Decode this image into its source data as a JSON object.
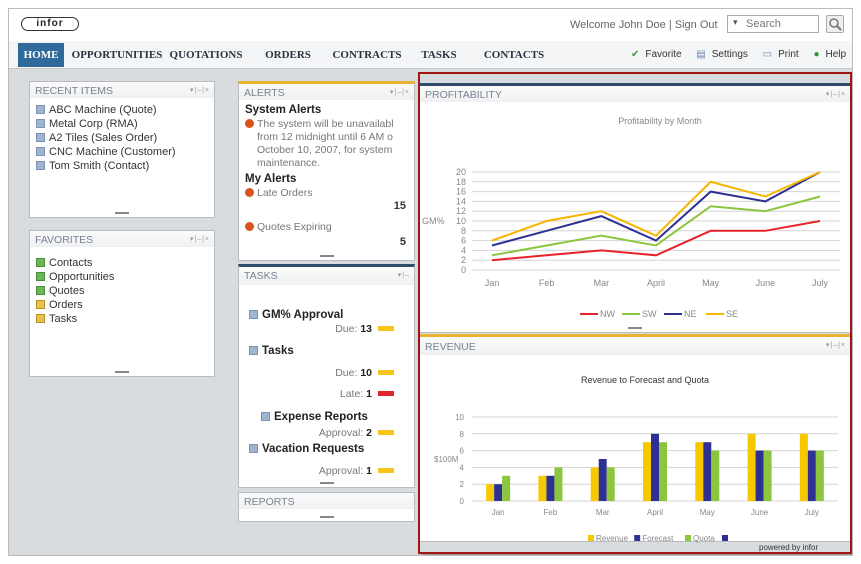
{
  "app": {
    "logo": "infor",
    "welcome": "Welcome John Doe | Sign Out",
    "search_placeholder": "Search",
    "search_dropdown": "▾",
    "powered": "powered by infor"
  },
  "nav": {
    "tabs": [
      "HOME",
      "OPPORTUNITIES",
      "QUOTATIONS",
      "ORDERS",
      "CONTRACTS",
      "TASKS",
      "CONTACTS"
    ],
    "active": "HOME"
  },
  "tools": {
    "favorite": "Favorite",
    "settings": "Settings",
    "print": "Print",
    "help": "Help",
    "more": ">>"
  },
  "recent": {
    "title": "RECENT ITEMS",
    "items": [
      "ABC Machine (Quote)",
      "Metal Corp (RMA)",
      "A2 Tiles (Sales Order)",
      "CNC Machine (Customer)",
      "Tom Smith (Contact)"
    ]
  },
  "favorites": {
    "title": "FAVORITES",
    "items": [
      "Contacts",
      "Opportunities",
      "Quotes",
      "Orders",
      "Tasks"
    ]
  },
  "alerts": {
    "title": "ALERTS",
    "system_title": "System Alerts",
    "system_text": [
      "The system will be unavailabl",
      "from 12 midnight until 6 AM o",
      "October 10, 2007, for system",
      "maintenance."
    ],
    "my_title": "My Alerts",
    "late_label": "Late Orders",
    "late_count": "15",
    "exp_label": "Quotes Expiring",
    "exp_count": "5"
  },
  "tasks": {
    "title": "TASKS",
    "gm": "GM% Approval",
    "gm_due_label": "Due:",
    "gm_due": "13",
    "tasks_label": "Tasks",
    "due_label": "Due:",
    "due": "10",
    "late_label": "Late:",
    "late": "1",
    "exp": "Expense Reports",
    "exp_appr_label": "Approval:",
    "exp_appr": "2",
    "vac": "Vacation Requests",
    "vac_appr_label": "Approval:",
    "vac_appr": "1"
  },
  "reports": {
    "title": "REPORTS"
  },
  "profitability": {
    "title": "PROFITABILITY"
  },
  "revenue": {
    "title": "REVENUE"
  },
  "colors": {
    "nw": "#e8242b",
    "sw": "#8cc63f",
    "ne": "#2e3192",
    "se": "#f7b500",
    "revenue": "#f7c800",
    "forecast": "#2e3192",
    "quota": "#8cc63f",
    "accent": "#2f6a9a",
    "highlight": "#a31414"
  },
  "chart_data": [
    {
      "type": "line",
      "title": "Profitability by Month",
      "ylabel": "GM%",
      "categories": [
        "Jan",
        "Feb",
        "Mar",
        "April",
        "May",
        "June",
        "July"
      ],
      "ylim": [
        0,
        20
      ],
      "yticks": [
        0,
        2,
        4,
        6,
        8,
        10,
        12,
        14,
        16,
        18,
        20
      ],
      "grid": true,
      "legend_position": "bottom",
      "series": [
        {
          "name": "NW",
          "values": [
            2,
            3,
            4,
            3,
            8,
            8,
            10
          ]
        },
        {
          "name": "SW",
          "values": [
            3,
            5,
            7,
            5,
            13,
            12,
            15
          ]
        },
        {
          "name": "NE",
          "values": [
            5,
            8,
            11,
            6,
            16,
            14,
            20
          ]
        },
        {
          "name": "SE",
          "values": [
            6,
            10,
            12,
            7,
            18,
            15,
            20
          ]
        }
      ]
    },
    {
      "type": "bar",
      "title": "Revenue to Forecast and Quota",
      "ylabel": "$100M",
      "categories": [
        "Jan",
        "Feb",
        "Mar",
        "April",
        "May",
        "June",
        "July"
      ],
      "ylim": [
        0,
        10
      ],
      "yticks": [
        0,
        2,
        4,
        6,
        8,
        10
      ],
      "grid": true,
      "legend_position": "bottom",
      "series": [
        {
          "name": "Revenue",
          "values": [
            2,
            3,
            4,
            7,
            7,
            8,
            8
          ]
        },
        {
          "name": "Forecast",
          "values": [
            2,
            3,
            5,
            8,
            7,
            6,
            6
          ]
        },
        {
          "name": "Quota",
          "values": [
            3,
            4,
            4,
            7,
            6,
            6,
            6
          ]
        }
      ]
    }
  ]
}
